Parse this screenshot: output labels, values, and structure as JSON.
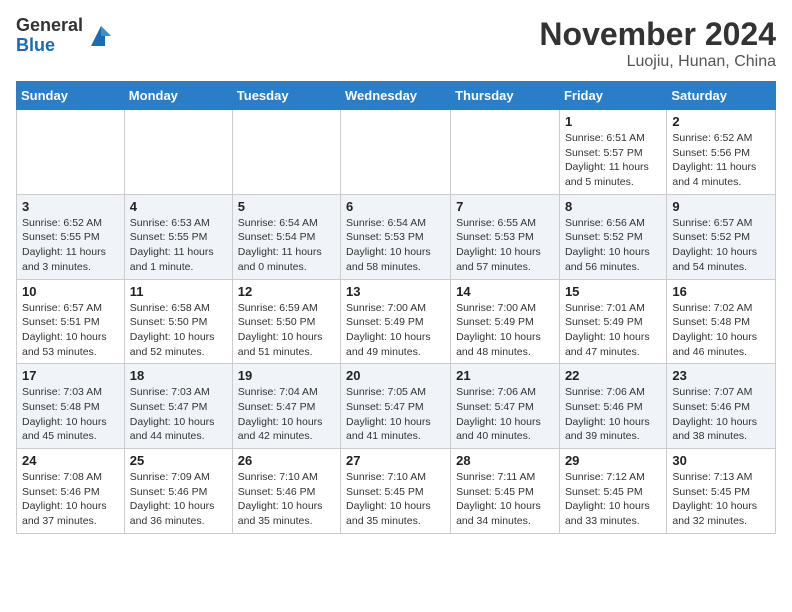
{
  "header": {
    "logo": {
      "general": "General",
      "blue": "Blue"
    },
    "month": "November 2024",
    "location": "Luojiu, Hunan, China"
  },
  "weekdays": [
    "Sunday",
    "Monday",
    "Tuesday",
    "Wednesday",
    "Thursday",
    "Friday",
    "Saturday"
  ],
  "weeks": [
    [
      {
        "day": null
      },
      {
        "day": null
      },
      {
        "day": null
      },
      {
        "day": null
      },
      {
        "day": null
      },
      {
        "day": 1,
        "sunrise": "Sunrise: 6:51 AM",
        "sunset": "Sunset: 5:57 PM",
        "daylight": "Daylight: 11 hours and 5 minutes."
      },
      {
        "day": 2,
        "sunrise": "Sunrise: 6:52 AM",
        "sunset": "Sunset: 5:56 PM",
        "daylight": "Daylight: 11 hours and 4 minutes."
      }
    ],
    [
      {
        "day": 3,
        "sunrise": "Sunrise: 6:52 AM",
        "sunset": "Sunset: 5:55 PM",
        "daylight": "Daylight: 11 hours and 3 minutes."
      },
      {
        "day": 4,
        "sunrise": "Sunrise: 6:53 AM",
        "sunset": "Sunset: 5:55 PM",
        "daylight": "Daylight: 11 hours and 1 minute."
      },
      {
        "day": 5,
        "sunrise": "Sunrise: 6:54 AM",
        "sunset": "Sunset: 5:54 PM",
        "daylight": "Daylight: 11 hours and 0 minutes."
      },
      {
        "day": 6,
        "sunrise": "Sunrise: 6:54 AM",
        "sunset": "Sunset: 5:53 PM",
        "daylight": "Daylight: 10 hours and 58 minutes."
      },
      {
        "day": 7,
        "sunrise": "Sunrise: 6:55 AM",
        "sunset": "Sunset: 5:53 PM",
        "daylight": "Daylight: 10 hours and 57 minutes."
      },
      {
        "day": 8,
        "sunrise": "Sunrise: 6:56 AM",
        "sunset": "Sunset: 5:52 PM",
        "daylight": "Daylight: 10 hours and 56 minutes."
      },
      {
        "day": 9,
        "sunrise": "Sunrise: 6:57 AM",
        "sunset": "Sunset: 5:52 PM",
        "daylight": "Daylight: 10 hours and 54 minutes."
      }
    ],
    [
      {
        "day": 10,
        "sunrise": "Sunrise: 6:57 AM",
        "sunset": "Sunset: 5:51 PM",
        "daylight": "Daylight: 10 hours and 53 minutes."
      },
      {
        "day": 11,
        "sunrise": "Sunrise: 6:58 AM",
        "sunset": "Sunset: 5:50 PM",
        "daylight": "Daylight: 10 hours and 52 minutes."
      },
      {
        "day": 12,
        "sunrise": "Sunrise: 6:59 AM",
        "sunset": "Sunset: 5:50 PM",
        "daylight": "Daylight: 10 hours and 51 minutes."
      },
      {
        "day": 13,
        "sunrise": "Sunrise: 7:00 AM",
        "sunset": "Sunset: 5:49 PM",
        "daylight": "Daylight: 10 hours and 49 minutes."
      },
      {
        "day": 14,
        "sunrise": "Sunrise: 7:00 AM",
        "sunset": "Sunset: 5:49 PM",
        "daylight": "Daylight: 10 hours and 48 minutes."
      },
      {
        "day": 15,
        "sunrise": "Sunrise: 7:01 AM",
        "sunset": "Sunset: 5:49 PM",
        "daylight": "Daylight: 10 hours and 47 minutes."
      },
      {
        "day": 16,
        "sunrise": "Sunrise: 7:02 AM",
        "sunset": "Sunset: 5:48 PM",
        "daylight": "Daylight: 10 hours and 46 minutes."
      }
    ],
    [
      {
        "day": 17,
        "sunrise": "Sunrise: 7:03 AM",
        "sunset": "Sunset: 5:48 PM",
        "daylight": "Daylight: 10 hours and 45 minutes."
      },
      {
        "day": 18,
        "sunrise": "Sunrise: 7:03 AM",
        "sunset": "Sunset: 5:47 PM",
        "daylight": "Daylight: 10 hours and 44 minutes."
      },
      {
        "day": 19,
        "sunrise": "Sunrise: 7:04 AM",
        "sunset": "Sunset: 5:47 PM",
        "daylight": "Daylight: 10 hours and 42 minutes."
      },
      {
        "day": 20,
        "sunrise": "Sunrise: 7:05 AM",
        "sunset": "Sunset: 5:47 PM",
        "daylight": "Daylight: 10 hours and 41 minutes."
      },
      {
        "day": 21,
        "sunrise": "Sunrise: 7:06 AM",
        "sunset": "Sunset: 5:47 PM",
        "daylight": "Daylight: 10 hours and 40 minutes."
      },
      {
        "day": 22,
        "sunrise": "Sunrise: 7:06 AM",
        "sunset": "Sunset: 5:46 PM",
        "daylight": "Daylight: 10 hours and 39 minutes."
      },
      {
        "day": 23,
        "sunrise": "Sunrise: 7:07 AM",
        "sunset": "Sunset: 5:46 PM",
        "daylight": "Daylight: 10 hours and 38 minutes."
      }
    ],
    [
      {
        "day": 24,
        "sunrise": "Sunrise: 7:08 AM",
        "sunset": "Sunset: 5:46 PM",
        "daylight": "Daylight: 10 hours and 37 minutes."
      },
      {
        "day": 25,
        "sunrise": "Sunrise: 7:09 AM",
        "sunset": "Sunset: 5:46 PM",
        "daylight": "Daylight: 10 hours and 36 minutes."
      },
      {
        "day": 26,
        "sunrise": "Sunrise: 7:10 AM",
        "sunset": "Sunset: 5:46 PM",
        "daylight": "Daylight: 10 hours and 35 minutes."
      },
      {
        "day": 27,
        "sunrise": "Sunrise: 7:10 AM",
        "sunset": "Sunset: 5:45 PM",
        "daylight": "Daylight: 10 hours and 35 minutes."
      },
      {
        "day": 28,
        "sunrise": "Sunrise: 7:11 AM",
        "sunset": "Sunset: 5:45 PM",
        "daylight": "Daylight: 10 hours and 34 minutes."
      },
      {
        "day": 29,
        "sunrise": "Sunrise: 7:12 AM",
        "sunset": "Sunset: 5:45 PM",
        "daylight": "Daylight: 10 hours and 33 minutes."
      },
      {
        "day": 30,
        "sunrise": "Sunrise: 7:13 AM",
        "sunset": "Sunset: 5:45 PM",
        "daylight": "Daylight: 10 hours and 32 minutes."
      }
    ]
  ]
}
